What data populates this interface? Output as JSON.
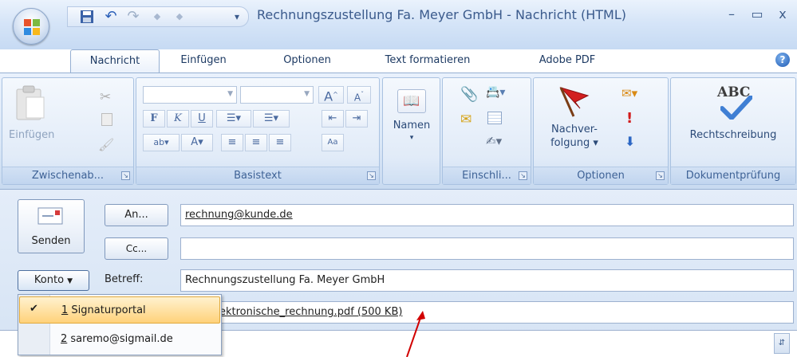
{
  "window": {
    "title": "Rechnungszustellung Fa. Meyer GmbH  -  Nachricht (HTML)",
    "minimize": "–",
    "maximize": "▭",
    "close": "x"
  },
  "quick_access": {
    "save": "💾",
    "undo": "↶",
    "redo": "↷",
    "prev": "◆",
    "next": "◆",
    "customize": "▾"
  },
  "tabs": [
    "Nachricht",
    "Einfügen",
    "Optionen",
    "Text formatieren",
    "Adobe PDF"
  ],
  "help_icon": "?",
  "ribbon": {
    "clipboard": {
      "label": "Zwischenab...",
      "paste": "Einfügen"
    },
    "basic_text": {
      "label": "Basistext",
      "bold": "F",
      "italic": "K",
      "underline": "U",
      "grow": "A",
      "shrink": "A",
      "highlight": "ab",
      "font_color": "A"
    },
    "names": {
      "label": "Namen"
    },
    "include": {
      "label": "Einschli..."
    },
    "options": {
      "label": "Optionen",
      "follow_up_line1": "Nachver-",
      "follow_up_line2": "folgung"
    },
    "proofing": {
      "label": "Dokumentprüfung",
      "spelling": "Rechtschreibung",
      "abc": "ABC"
    }
  },
  "compose": {
    "send": "Senden",
    "to_button": "An...",
    "cc_button": "Cc...",
    "to_value": "rechnung@kunde.de",
    "cc_value": "",
    "account_button": "Konto",
    "subject_label": "Betreff:",
    "subject_value": "Rechnungszustellung Fa. Meyer GmbH",
    "attachment_value": "ektronische_rechnung.pdf (500 KB)"
  },
  "account_menu": {
    "items": [
      {
        "accel": "1",
        "label": " Signaturportal",
        "checked": true
      },
      {
        "accel": "2",
        "label": " saremo@sigmail.de",
        "checked": false
      }
    ],
    "check": "✔"
  },
  "colors": {
    "accent": "#3e6296",
    "highlight": "#ffd27a",
    "annotation": "#d10000"
  }
}
